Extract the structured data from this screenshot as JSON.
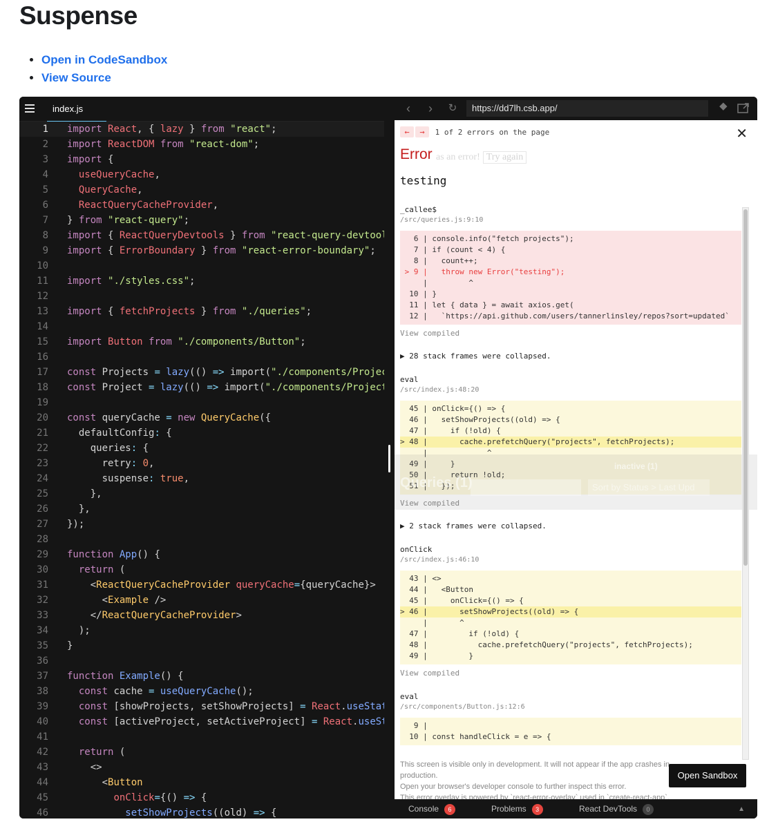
{
  "page": {
    "title": "Suspense",
    "links": [
      "Open in CodeSandbox",
      "View Source"
    ]
  },
  "editor": {
    "file_tab": "index.js",
    "menu_icon": "hamburger-menu-icon",
    "active_line": 1,
    "lines": [
      [
        [
          "k",
          "import "
        ],
        [
          "m",
          "React"
        ],
        [
          "",
          "{, "
        ],
        [
          "",
          ""
        ]
      ],
      [
        [
          "k",
          "import "
        ],
        [
          "m",
          "ReactDOM "
        ],
        [
          "k",
          "from "
        ],
        [
          "s",
          "\"react-dom\""
        ],
        [
          "",
          ";"
        ]
      ]
    ]
  },
  "preview": {
    "url": "https://dd7lh.csb.app/",
    "overlay": {
      "counter": "1 of 2 errors on the page",
      "error_title": "Error",
      "ghost_text": "as an error!",
      "ghost_button": "Try again",
      "message": "testing",
      "collapsed_1": "▶ 28 stack frames were collapsed.",
      "collapsed_2": "▶ 2 stack frames were collapsed.",
      "view_compiled": "View compiled",
      "footer_lines": [
        "This screen is visible only in development. It will not appear if the app crashes in production.",
        "Open your browser's developer console to further inspect this error.",
        "This error overlay is powered by `react-error-overlay` used in `create-react-app`."
      ],
      "open_sandbox": "Open Sandbox",
      "devtools_ghost": {
        "title": "Queries (1)",
        "sort": "Sort by Status > Last Upd",
        "inactive": "inactive (1)",
        "query_key": "[\"projects\"]"
      },
      "frames": [
        {
          "name": "_callee$",
          "loc": "/src/queries.js:9:10",
          "style": "red",
          "lines": [
            "   6 | console.info(\"fetch projects\");",
            "   7 | if (count < 4) {",
            "   8 |   count++;",
            " > 9 |   throw new Error(\"testing\");",
            "     |         ^",
            "  10 | }",
            "  11 | let { data } = await axios.get(",
            "  12 |   `https://api.github.com/users/tannerlinsley/repos?sort=updated`"
          ],
          "highlight": 3
        },
        {
          "name": "eval",
          "loc": "/src/index.js:48:20",
          "style": "yellow",
          "lines": [
            "  45 | onClick={() => {",
            "  46 |   setShowProjects((old) => {",
            "  47 |     if (!old) {",
            "> 48 |       cache.prefetchQuery(\"projects\", fetchProjects);",
            "     |             ^",
            "  49 |     }",
            "  50 |     return !old;",
            "  51 |   });"
          ],
          "highlight": 3
        },
        {
          "name": "onClick",
          "loc": "/src/index.js:46:10",
          "style": "yellow",
          "lines": [
            "  43 | <>",
            "  44 |   <Button",
            "  45 |     onClick={() => {",
            "> 46 |       setShowProjects((old) => {",
            "     |       ^",
            "  47 |         if (!old) {",
            "  48 |           cache.prefetchQuery(\"projects\", fetchProjects);",
            "  49 |         }"
          ],
          "highlight": 3
        },
        {
          "name": "eval",
          "loc": "/src/components/Button.js:12:6",
          "style": "yellow",
          "lines": [
            "   9 |",
            "  10 | const handleClick = e => {"
          ],
          "highlight": -1
        }
      ]
    },
    "bottom_bar": [
      {
        "label": "Console",
        "count": "6",
        "color": "red"
      },
      {
        "label": "Problems",
        "count": "3",
        "color": "red"
      },
      {
        "label": "React DevTools",
        "count": "0",
        "color": "gray"
      }
    ]
  }
}
